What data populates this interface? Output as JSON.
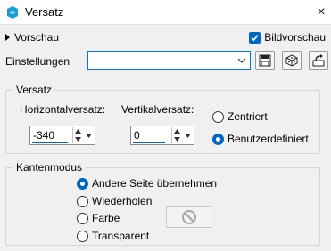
{
  "window": {
    "title": "Versatz",
    "icon": "paint-palette-icon",
    "close": "×"
  },
  "preview": {
    "label": "Vorschau",
    "icon": "expand-triangle-icon"
  },
  "live_preview": {
    "label": "Bildvorschau",
    "checked": true
  },
  "settings": {
    "label": "Einstellungen",
    "value": "",
    "buttons": [
      "save-icon",
      "random-dice-icon",
      "reset-icon"
    ]
  },
  "offset": {
    "legend": "Versatz",
    "horizontal": {
      "label": "Horizontalversatz:",
      "value": "-340"
    },
    "vertical": {
      "label": "Vertikalversatz:",
      "value": "0"
    },
    "options": [
      {
        "label": "Zentriert",
        "selected": false
      },
      {
        "label": "Benutzerdefiniert",
        "selected": true
      }
    ]
  },
  "edge_mode": {
    "legend": "Kantenmodus",
    "options": [
      {
        "label": "Andere Seite übernehmen",
        "selected": true
      },
      {
        "label": "Wiederholen",
        "selected": false
      },
      {
        "label": "Farbe",
        "selected": false
      },
      {
        "label": "Transparent",
        "selected": false
      }
    ],
    "color_swatch": {
      "icon": "no-color-icon",
      "enabled": false
    }
  },
  "colors": {
    "accent": "#0067c0",
    "titlebar": "#ffffff",
    "background": "#f0f0f0"
  }
}
